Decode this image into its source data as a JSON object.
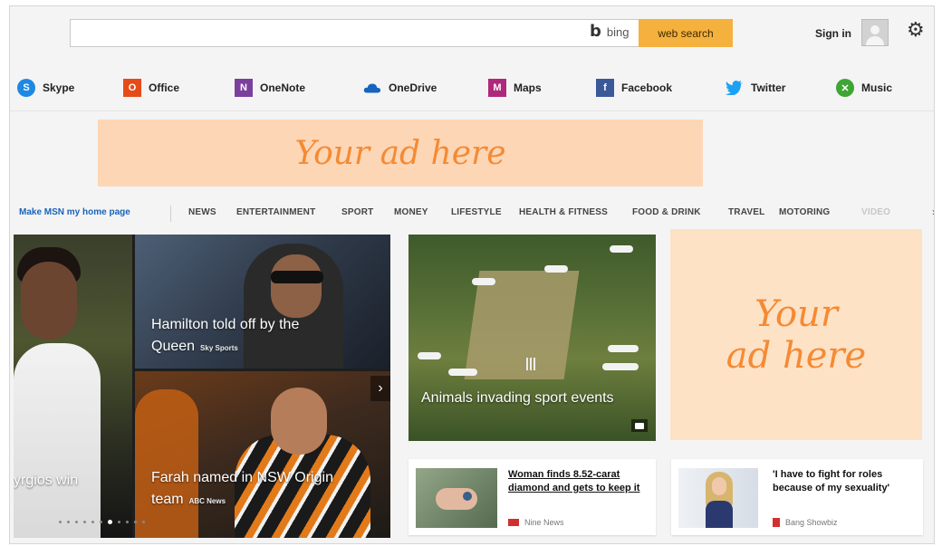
{
  "search": {
    "placeholder": "",
    "bing_label": "bing",
    "button_label": "web search"
  },
  "header": {
    "signin_label": "Sign in"
  },
  "quicklinks": [
    {
      "label": "Skype",
      "icon": "skype-icon",
      "color": "#1e88e5"
    },
    {
      "label": "Office",
      "icon": "office-icon",
      "color": "#e64a19"
    },
    {
      "label": "OneNote",
      "icon": "onenote-icon",
      "color": "#7b3f9e"
    },
    {
      "label": "OneDrive",
      "icon": "onedrive-icon",
      "color": "#1565c0"
    },
    {
      "label": "Maps",
      "icon": "maps-icon",
      "color": "#b0287b"
    },
    {
      "label": "Facebook",
      "icon": "facebook-icon",
      "color": "#3b5998"
    },
    {
      "label": "Twitter",
      "icon": "twitter-icon",
      "color": "#1da1f2"
    },
    {
      "label": "Music",
      "icon": "xbox-music-icon",
      "color": "#3fa535"
    }
  ],
  "ads": {
    "top": "Your ad here",
    "side_line1": "Your",
    "side_line2": "ad here"
  },
  "nav": {
    "home_link": "Make MSN my home page",
    "items": [
      "NEWS",
      "ENTERTAINMENT",
      "SPORT",
      "MONEY",
      "LIFESTYLE",
      "HEALTH & FITNESS",
      "FOOD & DRINK",
      "TRAVEL",
      "MOTORING",
      "VIDEO"
    ],
    "more": "›"
  },
  "hero": {
    "left_caption": "yrgios win",
    "top_caption_line1": "Hamilton told off by the",
    "top_caption_line2": "Queen",
    "top_source": "Sky Sports",
    "bottom_caption_line1": "Farah named in NSW Origin",
    "bottom_caption_line2": "team",
    "bottom_source": "ABC News",
    "next": "›",
    "slide_count": 11,
    "active_slide": 6
  },
  "cricket": {
    "caption": "Animals invading sport events"
  },
  "cards": [
    {
      "title": "Woman finds 8.52-carat diamond and gets to keep it",
      "source": "Nine News",
      "source_color": "#d32f2f"
    },
    {
      "title": "'I have to fight for roles because of my sexuality'",
      "source": "Bang Showbiz",
      "source_color": "#d32f2f"
    }
  ],
  "colors": {
    "accent": "#f5b13d",
    "ad_text": "#f58a33",
    "nav_link": "#1a63b8"
  }
}
